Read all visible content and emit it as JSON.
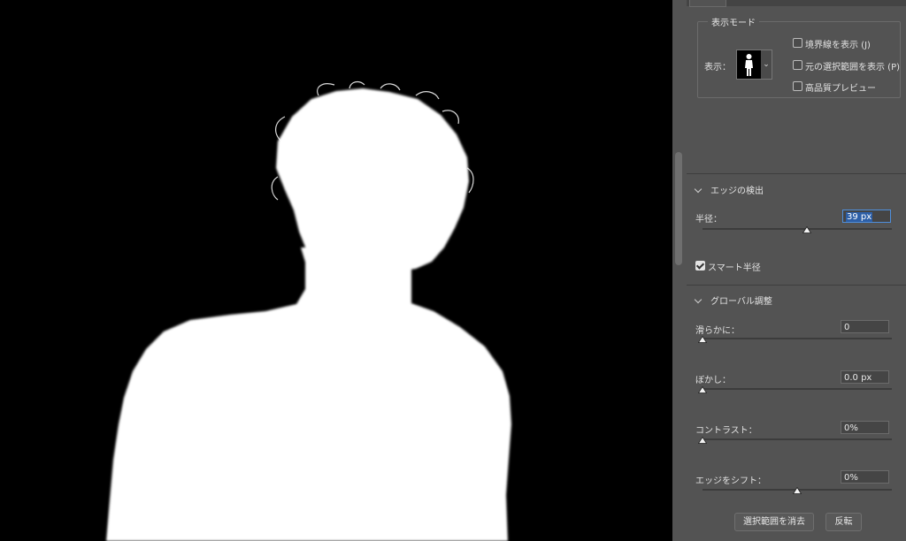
{
  "panel": {
    "display_mode": {
      "legend": "表示モード",
      "view_label": "表示：",
      "options": [
        {
          "label": "境界線を表示 (J)",
          "checked": false
        },
        {
          "label": "元の選択範囲を表示 (P)",
          "checked": false
        },
        {
          "label": "高品質プレビュー",
          "checked": false
        }
      ]
    },
    "edge_detection": {
      "title": "エッジの検出",
      "radius_label": "半径：",
      "radius_value": "39 px",
      "radius_slider": 0.55,
      "smart_radius_label": "スマート半径",
      "smart_radius_checked": true
    },
    "global_refinements": {
      "title": "グローバル調整",
      "smooth_label": "滑らかに：",
      "smooth_value": "0",
      "smooth_slider": 0.0,
      "feather_label": "ぼかし：",
      "feather_value": "0.0 px",
      "feather_slider": 0.0,
      "contrast_label": "コントラスト：",
      "contrast_value": "0%",
      "contrast_slider": 0.0,
      "shift_edge_label": "エッジをシフト：",
      "shift_edge_value": "0%",
      "shift_edge_slider": 0.5
    },
    "buttons": {
      "clear_selection": "選択範囲を消去",
      "invert": "反転"
    }
  },
  "colors": {
    "panel_bg": "#535353",
    "canvas_bg": "#000000",
    "mask": "#ffffff",
    "accent": "#4f8fdc"
  }
}
